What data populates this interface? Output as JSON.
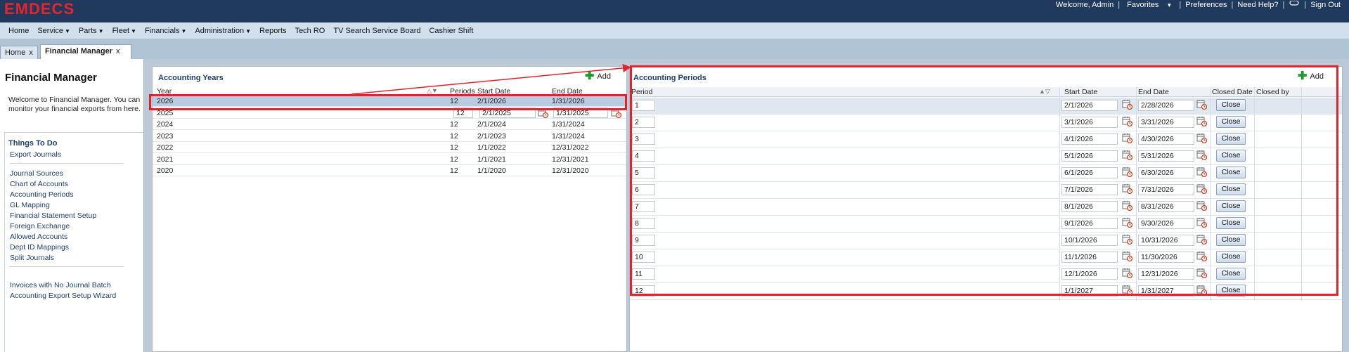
{
  "header": {
    "logo": "EMDECS",
    "welcome": "Welcome, Admin",
    "favorites": "Favorites",
    "preferences": "Preferences",
    "help": "Need Help?",
    "signout": "Sign Out",
    "bg_color": "#1f3a5c",
    "logo_color": "#e8232b"
  },
  "menu": [
    {
      "label": "Home",
      "dropdown": false
    },
    {
      "label": "Service",
      "dropdown": true
    },
    {
      "label": "Parts",
      "dropdown": true
    },
    {
      "label": "Fleet",
      "dropdown": true
    },
    {
      "label": "Financials",
      "dropdown": true
    },
    {
      "label": "Administration",
      "dropdown": true
    },
    {
      "label": "Reports",
      "dropdown": false
    },
    {
      "label": "Tech RO",
      "dropdown": false
    },
    {
      "label": "TV Search Service Board",
      "dropdown": false
    },
    {
      "label": "Cashier Shift",
      "dropdown": false
    }
  ],
  "tabs": [
    {
      "label": "Home",
      "active": false
    },
    {
      "label": "Financial Manager",
      "active": true
    }
  ],
  "left": {
    "title": "Financial Manager",
    "welcome": "Welcome to Financial Manager. You can monitor your financial exports from here.",
    "todo_title": "Things To Do",
    "links_group1": [
      "Export Journals"
    ],
    "links_group2": [
      "Journal Sources",
      "Chart of Accounts",
      "Accounting Periods",
      "GL Mapping",
      "Financial Statement Setup",
      "Foreign Exchange",
      "Allowed Accounts",
      "Dept ID Mappings",
      "Split Journals"
    ],
    "links_group3": [
      "Invoices with No Journal Batch",
      "Accounting Export Setup Wizard"
    ]
  },
  "years": {
    "title": "Accounting Years",
    "add_label": "Add",
    "columns": [
      "Year",
      "Periods",
      "Start Date",
      "End Date"
    ],
    "rows": [
      {
        "year": "2026",
        "periods": "12",
        "start": "2/1/2026",
        "end": "1/31/2026",
        "selected": true
      },
      {
        "year": "2025",
        "periods": "12",
        "start": "2/1/2025",
        "end": "1/31/2025",
        "editing": true
      },
      {
        "year": "2024",
        "periods": "12",
        "start": "2/1/2024",
        "end": "1/31/2024"
      },
      {
        "year": "2023",
        "periods": "12",
        "start": "2/1/2023",
        "end": "1/31/2024"
      },
      {
        "year": "2022",
        "periods": "12",
        "start": "1/1/2022",
        "end": "12/31/2022"
      },
      {
        "year": "2021",
        "periods": "12",
        "start": "1/1/2021",
        "end": "12/31/2021"
      },
      {
        "year": "2020",
        "periods": "12",
        "start": "1/1/2020",
        "end": "12/31/2020"
      }
    ]
  },
  "periods": {
    "title": "Accounting Periods",
    "add_label": "Add",
    "columns": [
      "Period",
      "Start Date",
      "End Date",
      "Closed Date",
      "Closed by"
    ],
    "close_label": "Close",
    "rows": [
      {
        "period": "1",
        "start": "2/1/2026",
        "end": "2/28/2026"
      },
      {
        "period": "2",
        "start": "3/1/2026",
        "end": "3/31/2026"
      },
      {
        "period": "3",
        "start": "4/1/2026",
        "end": "4/30/2026"
      },
      {
        "period": "4",
        "start": "5/1/2026",
        "end": "5/31/2026"
      },
      {
        "period": "5",
        "start": "6/1/2026",
        "end": "6/30/2026"
      },
      {
        "period": "6",
        "start": "7/1/2026",
        "end": "7/31/2026"
      },
      {
        "period": "7",
        "start": "8/1/2026",
        "end": "8/31/2026"
      },
      {
        "period": "8",
        "start": "9/1/2026",
        "end": "9/30/2026"
      },
      {
        "period": "9",
        "start": "10/1/2026",
        "end": "10/31/2026"
      },
      {
        "period": "10",
        "start": "11/1/2026",
        "end": "11/30/2026"
      },
      {
        "period": "11",
        "start": "12/1/2026",
        "end": "12/31/2026"
      },
      {
        "period": "12",
        "start": "1/1/2027",
        "end": "1/31/2027"
      }
    ]
  },
  "annotation_color": "#e3232b"
}
